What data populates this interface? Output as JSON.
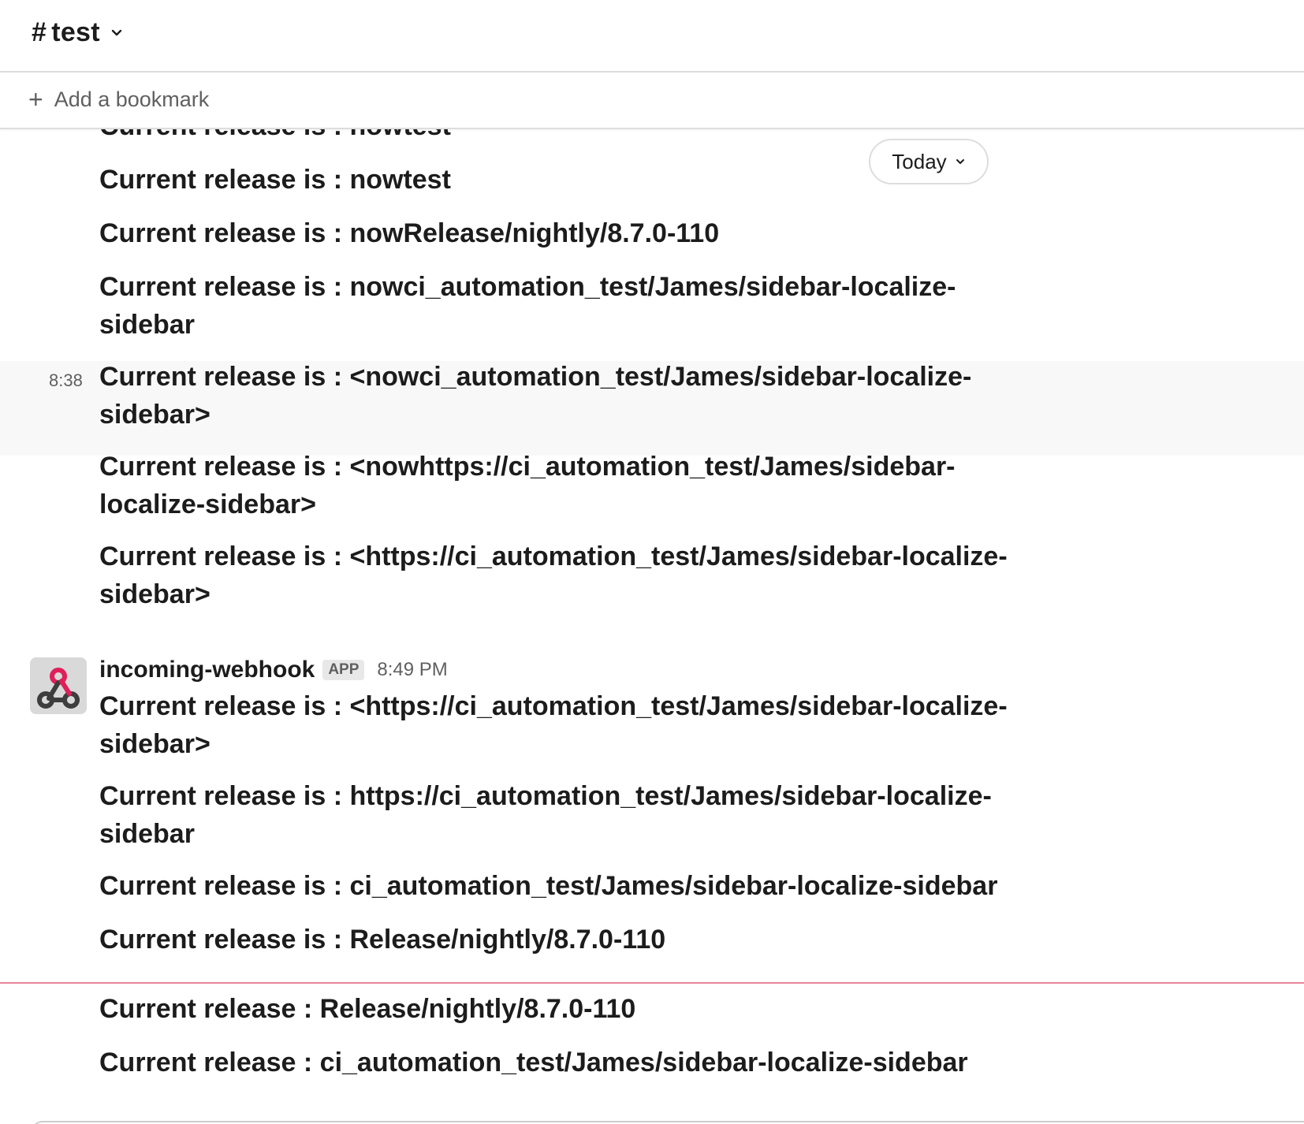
{
  "header": {
    "hash": "#",
    "channel_name": "test"
  },
  "bookmarks": {
    "add_label": "Add a bookmark"
  },
  "date_pill": {
    "label": "Today"
  },
  "messages_before": [
    "Current release is : nowtest",
    "Current release is : nowtest",
    "Current release is : nowRelease/nightly/8.7.0-110",
    "Current release is : nowci_automation_test/James/sidebar-localize-sidebar",
    "Current release is : <nowci_automation_test/James/sidebar-localize-sidebar>",
    "Current release is : <nowhttps://ci_automation_test/James/sidebar-localize-sidebar>",
    "Current release is : <https://ci_automation_test/James/sidebar-localize-sidebar>"
  ],
  "hover_timestamp": "8:38",
  "sender": {
    "name": "incoming-webhook",
    "badge": "APP",
    "time": "8:49 PM",
    "avatar_icon": "webhook-icon",
    "avatar_colors": {
      "bg": "#d9d9d9",
      "accent": "#e01e5a",
      "dark": "#3d3d3d"
    }
  },
  "messages_after": [
    "Current release is : <https://ci_automation_test/James/sidebar-localize-sidebar>",
    "Current release is : https://ci_automation_test/James/sidebar-localize-sidebar",
    "Current release is : ci_automation_test/James/sidebar-localize-sidebar",
    "Current release is : Release/nightly/8.7.0-110"
  ],
  "messages_new": [
    "Current release : Release/nightly/8.7.0-110",
    "Current release : ci_automation_test/James/sidebar-localize-sidebar"
  ],
  "colors": {
    "new_divider": "#e8849e",
    "text": "#1d1c1d",
    "muted": "#616061",
    "hover_bg": "#f8f8f8"
  }
}
